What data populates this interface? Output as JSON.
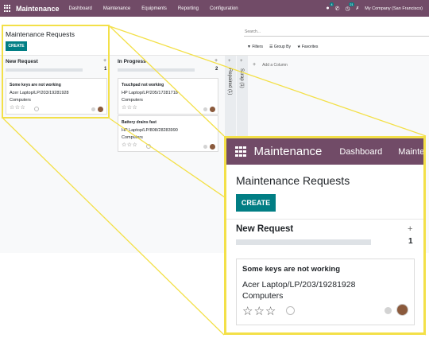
{
  "navbar": {
    "brand": "Maintenance",
    "items": [
      "Dashboard",
      "Maintenance",
      "Equipments",
      "Reporting",
      "Configuration"
    ],
    "chat_badge": "4",
    "activity_badge": "21",
    "company": "My Company (San Francisco)"
  },
  "control_panel": {
    "title": "Maintenance Requests",
    "create_label": "CREATE",
    "search_placeholder": "Search...",
    "filters_label": "Filters",
    "group_by_label": "Group By",
    "favorites_label": "Favorites"
  },
  "columns": [
    {
      "name": "New Request",
      "count": "1",
      "cards": [
        {
          "title": "Some keys are not working",
          "equipment": "Acer Laptop/LP/203/19281928",
          "category": "Computers"
        }
      ]
    },
    {
      "name": "In Progress",
      "count": "2",
      "cards": [
        {
          "title": "Touchpad not working",
          "equipment": "HP Laptop/LP/205/17281718",
          "category": "Computers"
        },
        {
          "title": "Battery drains fast",
          "equipment": "HP Laptop/LP/808/28283990",
          "category": "Computers"
        }
      ]
    }
  ],
  "folded_columns": [
    "Repaired (1)",
    "Scrap (1)"
  ],
  "add_column_label": "Add a Column",
  "zoom": {
    "brand": "Maintenance",
    "nav_items": [
      "Dashboard",
      "Mainte"
    ]
  },
  "colors": {
    "brand": "#714B67",
    "accent": "#017e84",
    "highlight": "#f3e048"
  },
  "icons": {
    "apps": "grid-icon",
    "star": "star-outline-icon",
    "clock": "clock-icon",
    "plus": "plus-icon"
  }
}
